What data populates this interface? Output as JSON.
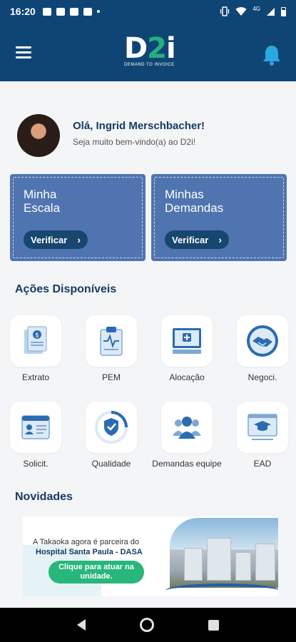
{
  "status_bar": {
    "time": "16:20",
    "network": "4G"
  },
  "header": {
    "logo_main": "D2i",
    "logo_sub": "DEMAND TO INVOICE"
  },
  "greeting": {
    "title": "Olá, Ingrid Merschbacher!",
    "subtitle": "Seja muito bem-vindo(a) ao D2i!"
  },
  "cards": [
    {
      "title": "Minha\nEscala",
      "button": "Verificar"
    },
    {
      "title": "Minhas\nDemandas",
      "button": "Verificar"
    }
  ],
  "actions_title": "Ações Disponíveis",
  "actions": [
    {
      "label": "Extrato",
      "icon": "document-money-icon"
    },
    {
      "label": "PEM",
      "icon": "clipboard-heartbeat-icon"
    },
    {
      "label": "Alocação",
      "icon": "monitor-plus-icon"
    },
    {
      "label": "Negoci.",
      "icon": "handshake-icon"
    },
    {
      "label": "Solicit.",
      "icon": "id-card-icon"
    },
    {
      "label": "Qualidade",
      "icon": "shield-check-icon"
    },
    {
      "label": "Demandas equipe",
      "icon": "team-icon"
    },
    {
      "label": "EAD",
      "icon": "graduation-monitor-icon"
    }
  ],
  "news_title": "Novidades",
  "banner": {
    "line1": "A Takaoka agora é parceira do",
    "line2": "Hospital Santa Paula - DASA",
    "cta": "Clique para atuar na unidade."
  },
  "colors": {
    "header": "#0f4574",
    "card": "#4f74b0",
    "card_button": "#17466f",
    "accent_green": "#28b77a",
    "bell": "#29a9e0"
  }
}
